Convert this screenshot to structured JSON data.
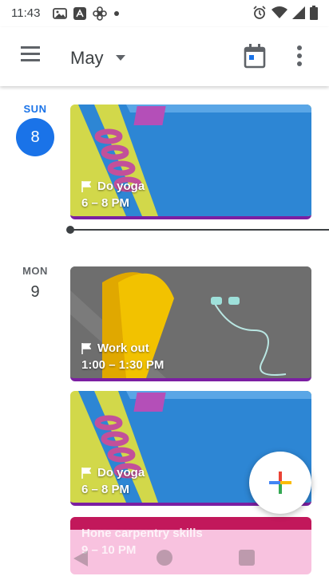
{
  "status_bar": {
    "time": "11:43"
  },
  "app_bar": {
    "month_label": "May"
  },
  "days": [
    {
      "dow": "SUN",
      "date": "8",
      "events": [
        {
          "title": "Do yoga",
          "time": "6 – 8 PM"
        }
      ]
    },
    {
      "dow": "MON",
      "date": "9",
      "events": [
        {
          "title": "Work out",
          "time": "1:00 – 1:30 PM"
        },
        {
          "title": "Do yoga",
          "time": "6 – 8 PM"
        }
      ]
    }
  ],
  "partial_event": {
    "title": "Hone carpentry skills",
    "time": "9 – 10 PM"
  },
  "colors": {
    "accent": "#1a73e8",
    "event_border": "#7b1fa2",
    "partial_event": "#f8b4d9"
  }
}
